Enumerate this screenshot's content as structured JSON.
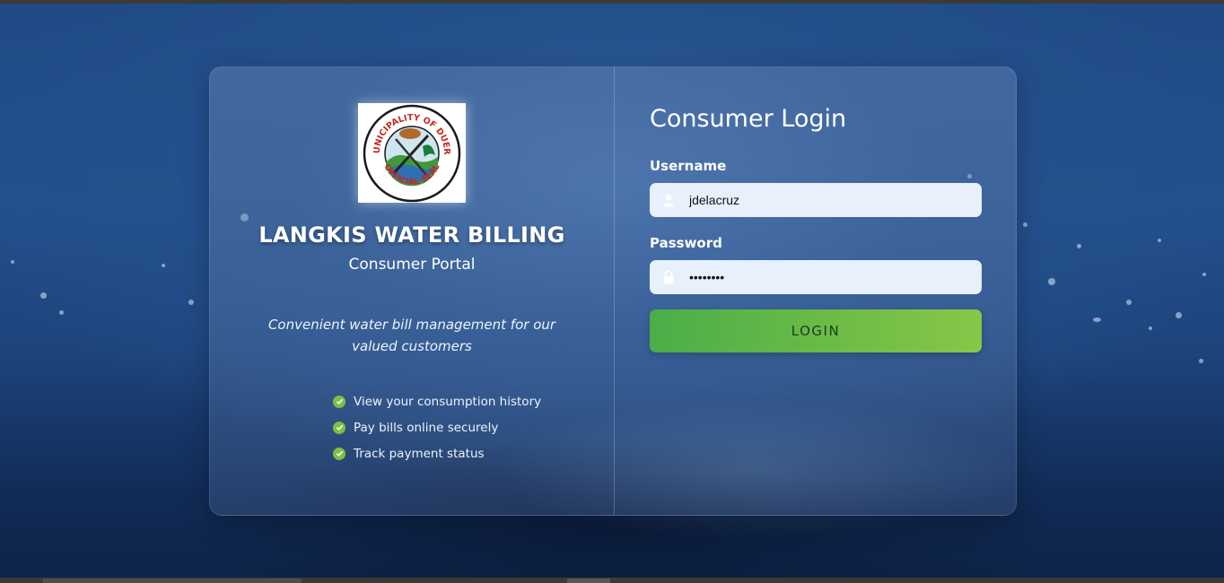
{
  "brand": {
    "title": "LANGKIS WATER BILLING",
    "subtitle": "Consumer Portal",
    "tagline": "Convenient water bill management for our valued customers",
    "logo_text_top": "MUNICIPALITY OF DUERO",
    "logo_text_bottom": "OFFICIAL SEAL"
  },
  "features": [
    {
      "label": "View your consumption history",
      "icon": "check-circle-icon"
    },
    {
      "label": "Pay bills online securely",
      "icon": "check-circle-icon"
    },
    {
      "label": "Track payment status",
      "icon": "check-circle-icon"
    }
  ],
  "login": {
    "title": "Consumer Login",
    "username_label": "Username",
    "username_value": "jdelacruz",
    "username_icon": "user-icon",
    "password_label": "Password",
    "password_value": "password",
    "password_icon": "lock-icon",
    "button_label": "LOGIN"
  },
  "colors": {
    "accent_green": "#7cc043",
    "button_gradient_start": "#4aae48",
    "button_gradient_end": "#87c748",
    "input_background": "#e8f0fb"
  }
}
